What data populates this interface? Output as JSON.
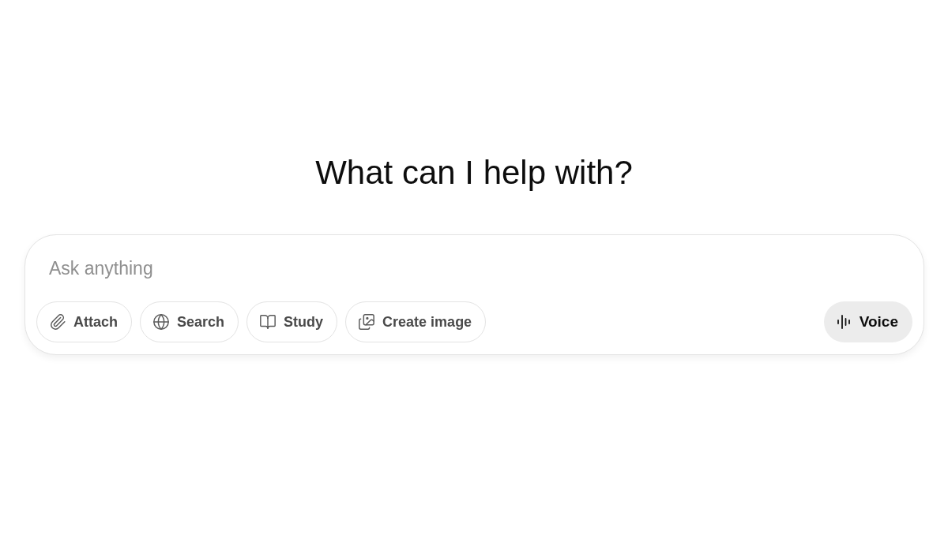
{
  "heading": "What can I help with?",
  "composer": {
    "placeholder": "Ask anything",
    "tools": [
      {
        "label": "Attach"
      },
      {
        "label": "Search"
      },
      {
        "label": "Study"
      },
      {
        "label": "Create image"
      }
    ],
    "voice_button": {
      "label": "Voice"
    }
  }
}
